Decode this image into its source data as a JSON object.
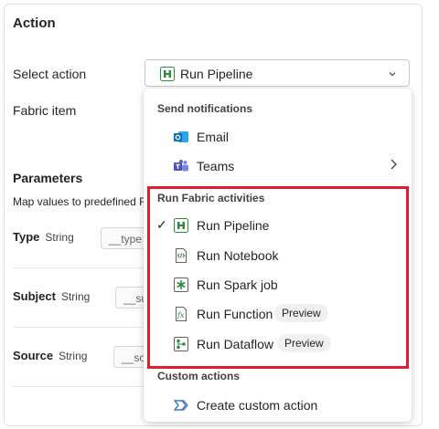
{
  "panel": {
    "title": "Action",
    "select_action_label": "Select action",
    "select_action_value": "Run Pipeline",
    "fabric_item_label": "Fabric item",
    "parameters_heading": "Parameters",
    "parameters_desc": "Map values to predefined F",
    "params": [
      {
        "name": "Type",
        "type": "String",
        "value": "__type"
      },
      {
        "name": "Subject",
        "type": "String",
        "value": "__su"
      },
      {
        "name": "Source",
        "type": "String",
        "value": "__so"
      }
    ]
  },
  "dropdown": {
    "group_notifications": "Send notifications",
    "email": "Email",
    "teams": "Teams",
    "group_fabric": "Run Fabric activities",
    "run_pipeline": "Run Pipeline",
    "run_notebook": "Run Notebook",
    "run_spark": "Run Spark job",
    "run_function": "Run Function",
    "run_function_badge": "Preview",
    "run_dataflow": "Run Dataflow",
    "run_dataflow_badge": "Preview",
    "group_custom": "Custom actions",
    "create_custom": "Create custom action",
    "checkmark": "✓"
  },
  "colors": {
    "highlight": "#e01e2d",
    "pipeline_green": "#2e8b3e",
    "email_blue": "#0f6cbd",
    "teams_purple": "#5b5fc7"
  }
}
